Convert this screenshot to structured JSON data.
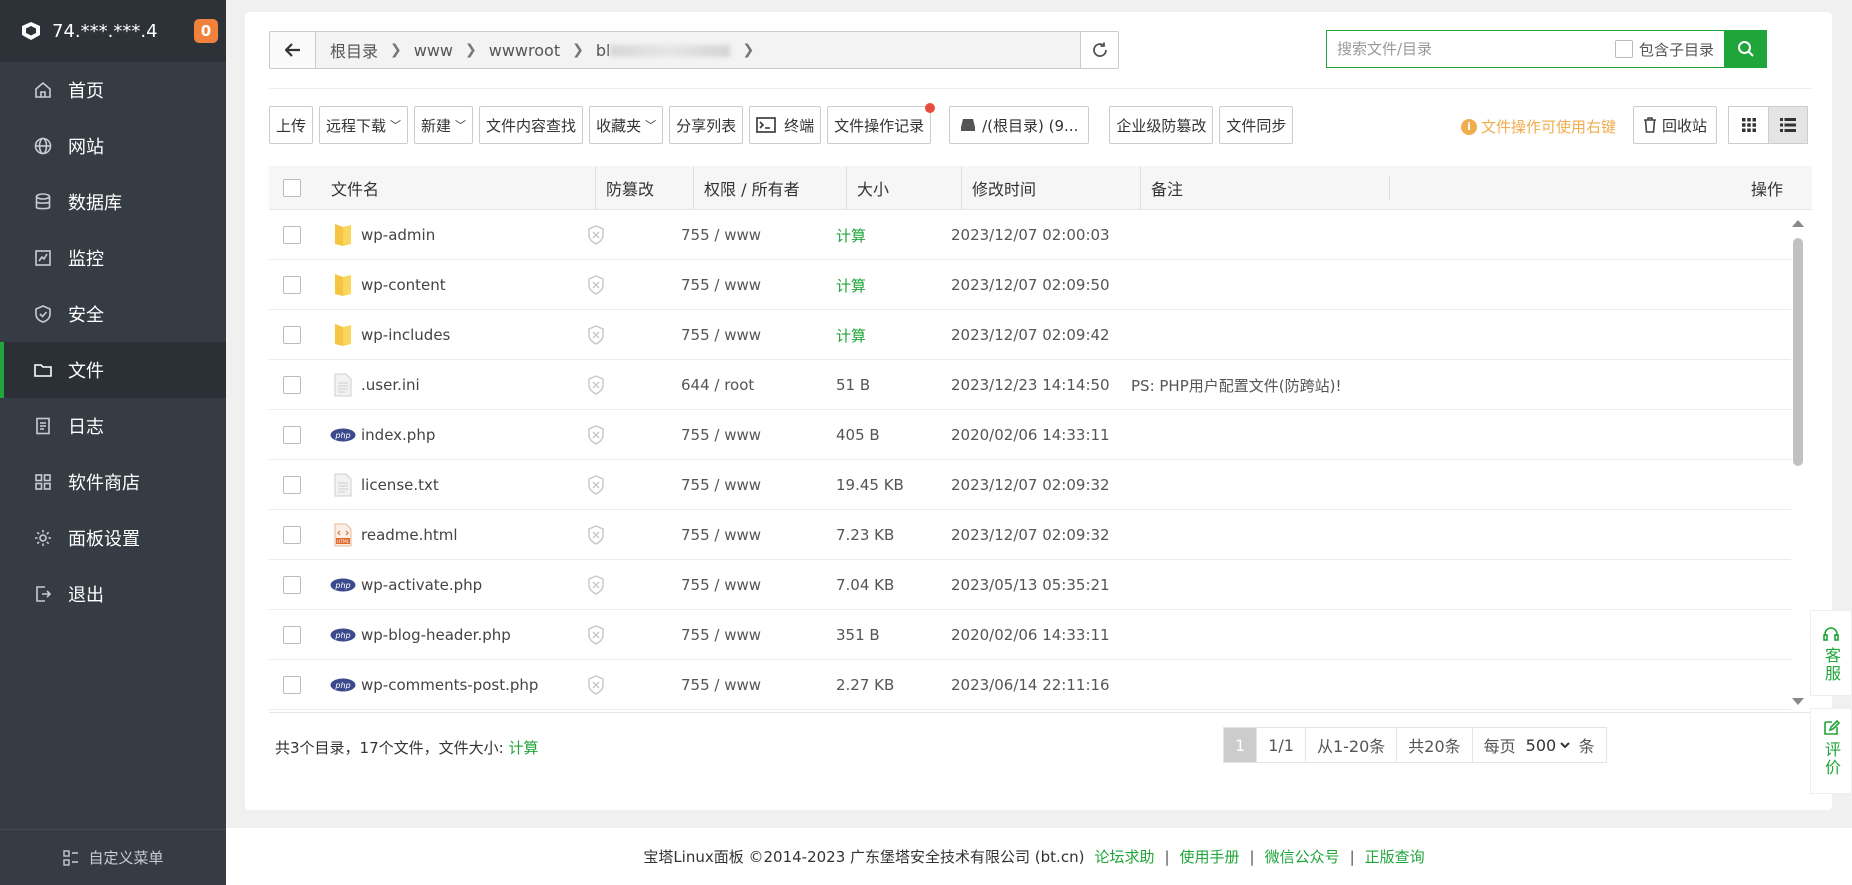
{
  "sidebar": {
    "ip": "74.***.***.4",
    "badge": "0",
    "items": [
      {
        "label": "首页",
        "icon": "home-icon"
      },
      {
        "label": "网站",
        "icon": "globe-icon"
      },
      {
        "label": "数据库",
        "icon": "database-icon"
      },
      {
        "label": "监控",
        "icon": "monitor-icon"
      },
      {
        "label": "安全",
        "icon": "shield-icon"
      },
      {
        "label": "文件",
        "icon": "folder-icon"
      },
      {
        "label": "日志",
        "icon": "log-icon"
      },
      {
        "label": "软件商店",
        "icon": "apps-icon"
      },
      {
        "label": "面板设置",
        "icon": "gear-icon"
      },
      {
        "label": "退出",
        "icon": "logout-icon"
      }
    ],
    "footer_label": "自定义菜单"
  },
  "breadcrumb": [
    "根目录",
    "www",
    "wwwroot",
    "bl"
  ],
  "search": {
    "placeholder": "搜索文件/目录",
    "subdir_label": "包含子目录"
  },
  "toolbar": {
    "upload": "上传",
    "remote_download": "远程下载",
    "new": "新建",
    "content_search": "文件内容查找",
    "favorites": "收藏夹",
    "share_list": "分享列表",
    "terminal": "终端",
    "op_log": "文件操作记录",
    "disk": "/(根目录) (9...",
    "tamper": "企业级防篡改",
    "sync": "文件同步",
    "tip": "文件操作可使用右键",
    "recycle": "回收站"
  },
  "columns": {
    "name": "文件名",
    "tamper": "防篡改",
    "perm": "权限 / 所有者",
    "size": "大小",
    "mtime": "修改时间",
    "note": "备注",
    "ops": "操作"
  },
  "files": [
    {
      "name": "wp-admin",
      "type": "folder",
      "perm": "755 / www",
      "size": "计算",
      "mtime": "2023/12/07 02:00:03",
      "note": ""
    },
    {
      "name": "wp-content",
      "type": "folder",
      "perm": "755 / www",
      "size": "计算",
      "mtime": "2023/12/07 02:09:50",
      "note": ""
    },
    {
      "name": "wp-includes",
      "type": "folder",
      "perm": "755 / www",
      "size": "计算",
      "mtime": "2023/12/07 02:09:42",
      "note": ""
    },
    {
      "name": ".user.ini",
      "type": "text",
      "perm": "644 / root",
      "size": "51 B",
      "mtime": "2023/12/23 14:14:50",
      "note": "PS: PHP用户配置文件(防跨站)!"
    },
    {
      "name": "index.php",
      "type": "php",
      "perm": "755 / www",
      "size": "405 B",
      "mtime": "2020/02/06 14:33:11",
      "note": ""
    },
    {
      "name": "license.txt",
      "type": "text",
      "perm": "755 / www",
      "size": "19.45 KB",
      "mtime": "2023/12/07 02:09:32",
      "note": ""
    },
    {
      "name": "readme.html",
      "type": "html",
      "perm": "755 / www",
      "size": "7.23 KB",
      "mtime": "2023/12/07 02:09:32",
      "note": ""
    },
    {
      "name": "wp-activate.php",
      "type": "php",
      "perm": "755 / www",
      "size": "7.04 KB",
      "mtime": "2023/05/13 05:35:21",
      "note": ""
    },
    {
      "name": "wp-blog-header.php",
      "type": "php",
      "perm": "755 / www",
      "size": "351 B",
      "mtime": "2020/02/06 14:33:11",
      "note": ""
    },
    {
      "name": "wp-comments-post.php",
      "type": "php",
      "perm": "755 / www",
      "size": "2.27 KB",
      "mtime": "2023/06/14 22:11:16",
      "note": ""
    }
  ],
  "summary": {
    "text": "共3个目录，17个文件，文件大小: ",
    "calc": "计算"
  },
  "pager": {
    "current": "1",
    "pages": "1/1",
    "range": "从1-20条",
    "total": "共20条",
    "per_page_label": "每页",
    "per_page_value": "500",
    "unit": "条"
  },
  "float": {
    "service": "客服",
    "review": "评价"
  },
  "page_footer": {
    "copyright": "宝塔Linux面板 ©2014-2023 广东堡塔安全技术有限公司 (bt.cn)",
    "links": [
      "论坛求助",
      "使用手册",
      "微信公众号",
      "正版查询"
    ]
  },
  "colors": {
    "accent": "#20a53a",
    "sidebar": "#363c44",
    "badge": "#f0823b",
    "tip": "#f0ad4e"
  }
}
